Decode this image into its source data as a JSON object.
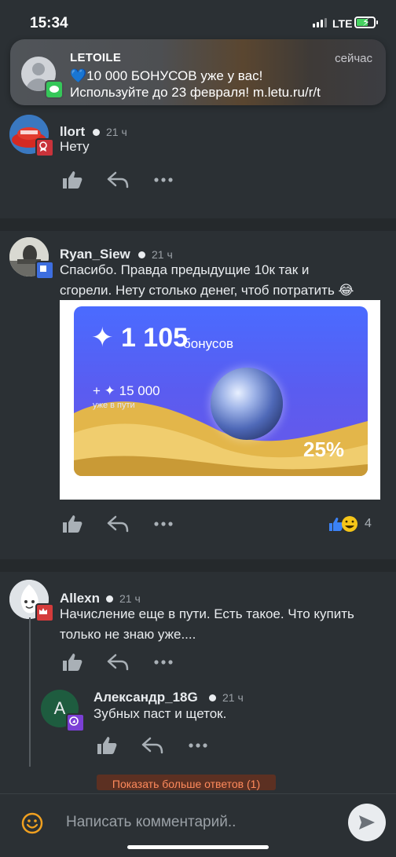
{
  "status_bar": {
    "time": "15:34",
    "network": "LTE"
  },
  "notification": {
    "app": "LETOILE",
    "when": "сейчас",
    "line1": "10 000 БОНУСОВ уже у вас!",
    "line2": "Используйте до 23 февраля! m.letu.ru/r/t"
  },
  "comments": [
    {
      "user": "llort",
      "ago": "21 ч",
      "text": "Нету"
    },
    {
      "user": "Ryan_Siew",
      "ago": "21 ч",
      "text_l1": "Спасибо. Правда предыдущие 10к так и",
      "text_l2": "сгорели. Нету столько денег, чтоб потратить 😂",
      "reactions_count": "4",
      "promo": {
        "amount": "1 105",
        "amount_label": "бонусов",
        "incoming": "+ ✦ 15 000",
        "incoming_label": "уже в пути",
        "percent": "25%"
      }
    },
    {
      "user": "Allexn",
      "ago": "21 ч",
      "text_l1": "Начисление еще в пути. Есть такое. Что купить",
      "text_l2": "только не знаю уже...."
    },
    {
      "user": "Александр_18G",
      "ago": "21 ч",
      "text": "Зубных паст и щеток.",
      "avatar_letter": "A"
    }
  ],
  "show_more_replies": "Показать больше ответов (1)",
  "composer": {
    "placeholder": "Написать комментарий.."
  },
  "colors": {
    "background": "#2b3034",
    "accent_orange": "#ff8a5c",
    "promo_blue": "#5a5cf0"
  }
}
